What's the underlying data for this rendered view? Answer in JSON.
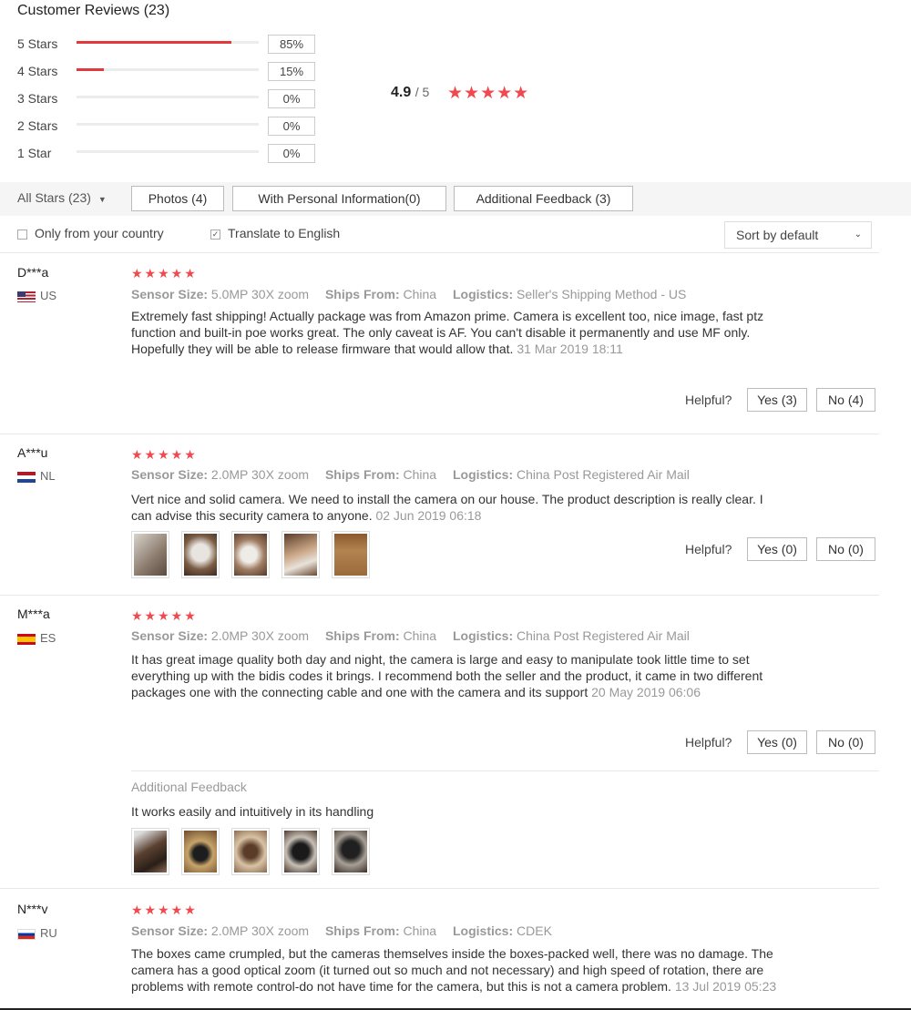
{
  "header": {
    "title": "Customer Reviews (23)"
  },
  "distribution": [
    {
      "label": "5 Stars",
      "percent": "85%",
      "fraction": 0.85
    },
    {
      "label": "4 Stars",
      "percent": "15%",
      "fraction": 0.15
    },
    {
      "label": "3 Stars",
      "percent": "0%",
      "fraction": 0
    },
    {
      "label": "2 Stars",
      "percent": "0%",
      "fraction": 0
    },
    {
      "label": "1 Star",
      "percent": "0%",
      "fraction": 0
    }
  ],
  "average": {
    "value": "4.9",
    "max": "/ 5",
    "stars": "★★★★★"
  },
  "filters": {
    "all_stars": "All Stars (23)",
    "buttons": [
      "Photos (4)",
      "With Personal Information(0)",
      "Additional Feedback (3)"
    ],
    "only_country": "Only from your country",
    "translate": "Translate to English",
    "sort": "Sort by default"
  },
  "labels": {
    "sensor": "Sensor Size:",
    "ships": "Ships From:",
    "logistics": "Logistics:",
    "helpful": "Helpful?",
    "additional_feedback": "Additional Feedback"
  },
  "reviews": [
    {
      "name": "D***a",
      "country": "US",
      "stars": "★★★★★",
      "sensor": "5.0MP 30X zoom",
      "ships": "China",
      "logistics": "Seller's Shipping Method - US",
      "text": "Extremely fast shipping! Actually package was from Amazon prime. Camera is excellent too, nice image, fast ptz function and built-in poe works great. The only caveat is AF. You can't disable it permanently and use MF only. Hopefully they will be able to release firmware that would allow that.",
      "date": "31 Mar 2019 18:11",
      "yes": "Yes (3)",
      "no": "No (4)"
    },
    {
      "name": "A***u",
      "country": "NL",
      "stars": "★★★★★",
      "sensor": "2.0MP 30X zoom",
      "ships": "China",
      "logistics": "China Post Registered Air Mail",
      "text": "Vert nice and solid camera. We need to install the camera on our house. The product description is really clear. I can advise this security camera to anyone.",
      "date": "02 Jun 2019 06:18",
      "yes": "Yes (0)",
      "no": "No (0)"
    },
    {
      "name": "M***a",
      "country": "ES",
      "stars": "★★★★★",
      "sensor": "2.0MP 30X zoom",
      "ships": "China",
      "logistics": "China Post Registered Air Mail",
      "text": "It has great image quality both day and night, the camera is large and easy to manipulate took little time to set everything up with the bidis codes it brings. I recommend both the seller and the product, it came in two different packages one with the connecting cable and one with the camera and its support",
      "date": "20 May 2019 06:06",
      "yes": "Yes (0)",
      "no": "No (0)",
      "additional": "It works easily and intuitively in its handling"
    },
    {
      "name": "N***v",
      "country": "RU",
      "stars": "★★★★★",
      "sensor": "2.0MP 30X zoom",
      "ships": "China",
      "logistics": "CDEK",
      "text": "The boxes came crumpled, but the cameras themselves inside the boxes-packed well, there was no damage. The camera has a good optical zoom (it turned out so much and not necessary) and high speed of rotation, there are problems with remote control-do not have time for the camera, but this is not a camera problem.",
      "date": "13 Jul 2019 05:23"
    }
  ]
}
